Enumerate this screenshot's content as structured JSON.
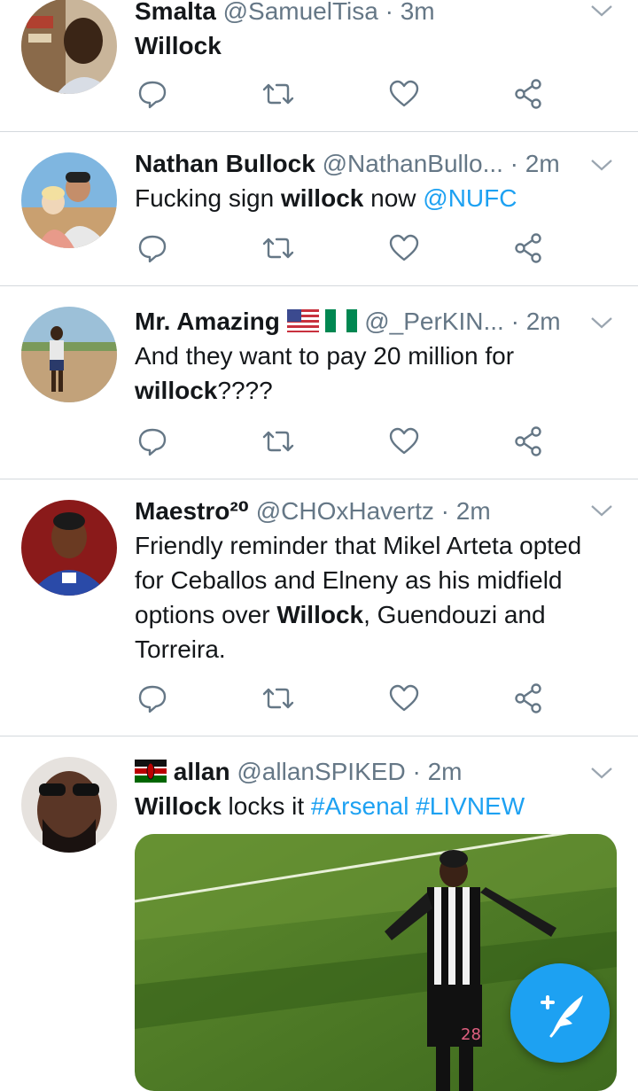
{
  "colors": {
    "accent": "#1da1f2",
    "text": "#14171a",
    "muted": "#657786",
    "divider": "#d4d9dd"
  },
  "tweets": [
    {
      "name": "Smalta",
      "handle": "@SamuelTisa",
      "sep": " · ",
      "time": "3m",
      "text": [
        {
          "t": "Willock",
          "b": true
        }
      ]
    },
    {
      "name": "Nathan Bullock",
      "handle": "@NathanBullo...",
      "sep": " · ",
      "time": "2m",
      "text": [
        {
          "t": "Fucking sign "
        },
        {
          "t": "willock",
          "b": true
        },
        {
          "t": " now "
        },
        {
          "t": "@NUFC",
          "link": true
        }
      ]
    },
    {
      "name": "Mr. Amazing",
      "flags": [
        "us-flag",
        "nigeria-flag"
      ],
      "handle": "@_PerKIN...",
      "sep": " · ",
      "time": "2m",
      "text": [
        {
          "t": "And they want to pay 20 million for "
        },
        {
          "t": "willock",
          "b": true
        },
        {
          "t": "????"
        }
      ]
    },
    {
      "name": "Maestro²⁰",
      "handle": "@CHOxHavertz",
      "sep": " · ",
      "time": "2m",
      "text": [
        {
          "t": "Friendly reminder that Mikel Arteta opted for Ceballos and Elneny as his midfield options over "
        },
        {
          "t": "Willock",
          "b": true
        },
        {
          "t": ", Guendouzi and Torreira."
        }
      ]
    },
    {
      "name": "allan",
      "prefix_flag": "kenya-flag",
      "handle": "@allanSPIKED",
      "sep": " · ",
      "time": "2m",
      "text": [
        {
          "t": "Willock",
          "b": true
        },
        {
          "t": " locks it "
        },
        {
          "t": "#Arsenal",
          "link": true
        },
        {
          "t": " "
        },
        {
          "t": "#LIVNEW",
          "link": true
        }
      ],
      "media": {
        "kind": "photo",
        "jersey_number": "28"
      }
    }
  ],
  "actions": [
    "reply-icon",
    "retweet-icon",
    "like-icon",
    "share-icon"
  ],
  "fab": {
    "icon": "compose-tweet-icon"
  }
}
